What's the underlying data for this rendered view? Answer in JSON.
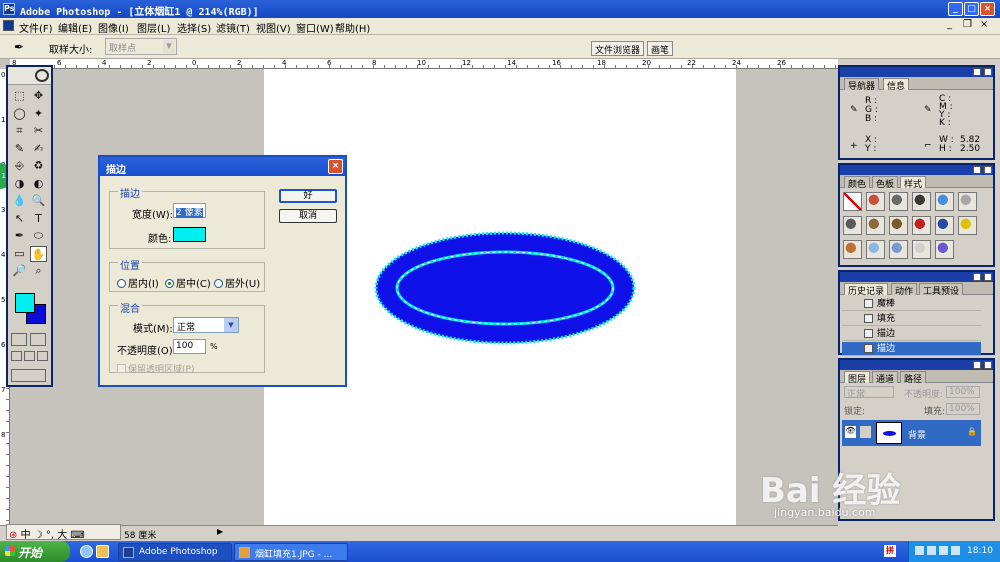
{
  "window": {
    "title": "Adobe Photoshop - [立体烟缸1 @ 214%(RGB)]",
    "icon_glyph": "Ps",
    "minimize": "_",
    "maximize": "□",
    "close": "×",
    "doc_minimize": "_",
    "doc_restore": "❐",
    "doc_close": "×"
  },
  "menu": [
    "文件(F)",
    "编辑(E)",
    "图像(I)",
    "图层(L)",
    "选择(S)",
    "滤镜(T)",
    "视图(V)",
    "窗口(W)",
    "帮助(H)"
  ],
  "options_bar": {
    "tool_glyph": "✒",
    "sample_size_label": "取样大小:",
    "sample_size_value": "取样点",
    "dropdown_arrow": "▼",
    "file_browser_tab": "文件浏览器",
    "brushes_tab": "画笔"
  },
  "rulers": {
    "top": [
      "8",
      "6",
      "4",
      "2",
      "0",
      "2",
      "4",
      "6",
      "8",
      "10",
      "12",
      "14",
      "16",
      "18",
      "20",
      "22",
      "24",
      "26"
    ],
    "left": [
      "0",
      "1",
      "2",
      "3",
      "4",
      "5",
      "6",
      "7",
      "8"
    ]
  },
  "status_badge": "18",
  "toolbox": {
    "tools": [
      "⬚",
      "✥",
      "◯",
      "✦",
      "⌗",
      "✂",
      "✎",
      "✍",
      "⎆",
      "♻",
      "◑",
      "◐",
      "💧",
      "🔍",
      "↖",
      "T",
      "✒",
      "⬭",
      "▭",
      "✋",
      "🔎",
      "⌕"
    ]
  },
  "stroke_dialog": {
    "title": "描边",
    "close": "×",
    "stroke_group": "描边",
    "width_label": "宽度(W):",
    "width_value": "2 像素",
    "color_label": "颜色:",
    "stroke_color": "#00f0f0",
    "ok_button": "好",
    "cancel_button": "取消",
    "position_group": "位置",
    "position_options": [
      "居内(I)",
      "居中(C)",
      "居外(U)"
    ],
    "position_selected": "居中(C)",
    "blend_group": "混合",
    "mode_label": "模式(M):",
    "mode_value": "正常",
    "mode_arrow": "▼",
    "opacity_label": "不透明度(O):",
    "opacity_value": "100",
    "opacity_unit": "%",
    "preserve_transparency": "保留透明区域(P)"
  },
  "canvas": {
    "shape_fill": "#1010e8",
    "stroke_color": "#00f0f0"
  },
  "navigator_panel": {
    "tabs": [
      "导航器",
      "信息"
    ],
    "active_tab": "信息",
    "rgb_labels": [
      "R :",
      "G :",
      "B :"
    ],
    "cmyk_labels": [
      "C :",
      "M :",
      "Y :",
      "K :"
    ],
    "xy_labels": [
      "X :",
      "Y :"
    ],
    "w_label": "W :",
    "w_value": "5.82",
    "h_label": "H :",
    "h_value": "2.50"
  },
  "color_panel": {
    "tabs": [
      "颜色",
      "色板",
      "样式"
    ],
    "active_tab": "样式",
    "style_swatches": [
      "#ffffff",
      "#c8503a",
      "#6a6a6a",
      "#3a3a3a",
      "#4a8ee0",
      "#a8a8a8",
      "#5a5a5a",
      "#8a6a3a",
      "#7a5a2a",
      "#c02020",
      "#2a4aa0",
      "#e0c000",
      "#c07030",
      "#8ab8e0",
      "#7a9ad0",
      "#d0d0d0",
      "#6a5ad0"
    ]
  },
  "history_panel": {
    "tabs": [
      "历史记录",
      "动作",
      "工具预设"
    ],
    "active_tab": "历史记录",
    "items": [
      "魔棒",
      "填充",
      "描边",
      "描边"
    ],
    "selected_index": 3
  },
  "layers_panel": {
    "tabs": [
      "图层",
      "通道",
      "路径"
    ],
    "active_tab": "图层",
    "blend_mode": "正常",
    "opacity_label": "不透明度:",
    "opacity_value": "100%",
    "lock_label": "锁定:",
    "fill_label": "填充:",
    "fill_value": "100%",
    "layer_name": "背景",
    "lock_glyph": "🔒",
    "eye_glyph": "👁"
  },
  "status": {
    "ime_text": "中 ☽ °, 大 ⌨",
    "ime_logo": "⊛",
    "zoom_readout": "58 厘米",
    "arrow": "▶"
  },
  "taskbar": {
    "start": "开始",
    "tasks": [
      "Adobe Photoshop ...",
      "烟缸填充1.JPG - ..."
    ],
    "lang": "拼",
    "clock": "18:10"
  },
  "watermark": {
    "main": "Bai 经验",
    "sub": "jingyan.baidu.com"
  }
}
